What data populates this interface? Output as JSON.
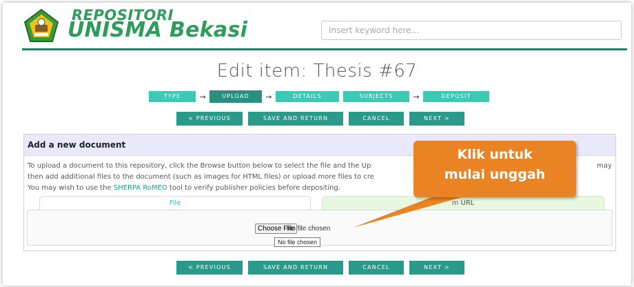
{
  "brand": {
    "line1": "REPOSITORI",
    "line2": "UNISMA Bekasi",
    "primary_color": "#2e9d5b"
  },
  "search": {
    "placeholder": "Insert keyword here..."
  },
  "page_title": "Edit item: Thesis #67",
  "workflow": {
    "steps": [
      "TYPE",
      "UPLOAD",
      "DETAILS",
      "SUBJECTS",
      "DEPOSIT"
    ],
    "active": "UPLOAD",
    "arrow": "→"
  },
  "nav_buttons": {
    "previous": "< PREVIOUS",
    "save_return": "SAVE AND RETURN",
    "cancel": "CANCEL",
    "next": "NEXT >"
  },
  "panel": {
    "heading": "Add a new document",
    "line1": "To upload a document to this repository, click the Browse button below to select the file and the Up",
    "line1_tail": "may",
    "line2": "then add additional files to the document (such as images for HTML files) or upload more files to cre",
    "line3_pre": "You may wish to use the ",
    "line3_link": "SHERPA RoMEO",
    "line3_post": " tool to verify publisher policies before depositing.",
    "tab_file": "File",
    "tab_url": "m URL"
  },
  "file_input": {
    "button": "Choose File",
    "status": "No file chosen",
    "tooltip": "No file chosen"
  },
  "callout": {
    "line1": "Klik untuk",
    "line2": "mulai unggah",
    "color": "#ea8323"
  },
  "colors": {
    "teal": "#2a9a8a",
    "teal_light": "#3cc9b6",
    "link": "#1a9b8f"
  }
}
